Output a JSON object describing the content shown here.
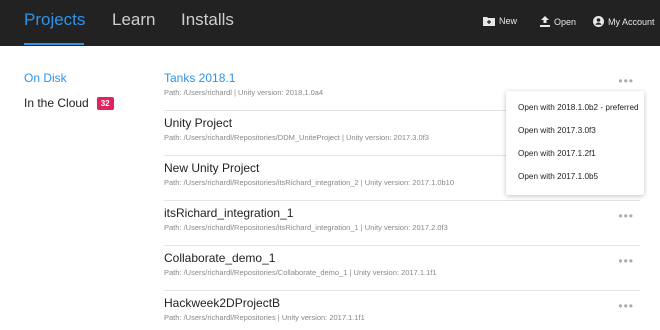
{
  "topbar": {
    "tabs": [
      {
        "label": "Projects"
      },
      {
        "label": "Learn"
      },
      {
        "label": "Installs"
      }
    ],
    "actions": {
      "new_label": "New",
      "open_label": "Open",
      "account_label": "My Account"
    }
  },
  "sidebar": {
    "items": [
      {
        "label": "On Disk"
      },
      {
        "label": "In the Cloud",
        "badge": "32"
      }
    ]
  },
  "projects": [
    {
      "name": "Tanks 2018.1",
      "meta": "Path: /Users/richardl | Unity version: 2018.1.0a4"
    },
    {
      "name": "Unity Project",
      "meta": "Path: /Users/richardl/Repositories/DDM_UniteProject | Unity version: 2017.3.0f3"
    },
    {
      "name": "New Unity Project",
      "meta": "Path: /Users/richardl/Repositories/itsRichard_integration_2 | Unity version: 2017.1.0b10"
    },
    {
      "name": "itsRichard_integration_1",
      "meta": "Path: /Users/richardl/Repositories/itsRichard_integration_1 | Unity version: 2017.2.0f3"
    },
    {
      "name": "Collaborate_demo_1",
      "meta": "Path: /Users/richardl/Repositories/Collaborate_demo_1 | Unity version: 2017.1.1f1"
    },
    {
      "name": "Hackweek2DProjectB",
      "meta": "Path: /Users/richardl/Repositories | Unity version: 2017.1.1f1"
    }
  ],
  "more_label": "•••",
  "open_with_menu": {
    "items": [
      {
        "label": "Open with 2018.1.0b2 - preferred"
      },
      {
        "label": "Open with 2017.3.0f3"
      },
      {
        "label": "Open with 2017.1.2f1"
      },
      {
        "label": "Open with 2017.1.0b5"
      }
    ]
  },
  "colors": {
    "accent": "#2f93e9",
    "topbar_bg": "#222222",
    "badge": "#e0245e"
  }
}
